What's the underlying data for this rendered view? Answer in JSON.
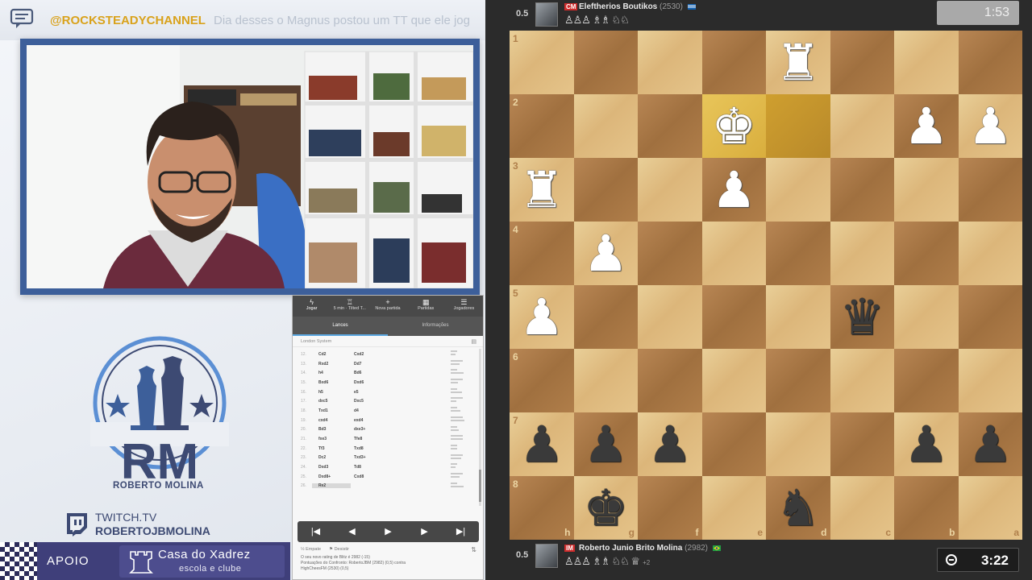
{
  "chat": {
    "user": "@ROCKSTEADYCHANNEL",
    "message": "Dia desses o Magnus postou um TT que ele jog"
  },
  "branding": {
    "logo_letters": "RM",
    "logo_name": "ROBERTO MOLINA",
    "twitch_line1": "TWITCH.TV",
    "twitch_line2": "ROBERTOJBMOLINA",
    "apoio_label": "APOIO",
    "sponsor_title": "Casa do Xadrez",
    "sponsor_subtitle": "escola e clube"
  },
  "panel": {
    "nav": [
      {
        "label": "Jogar",
        "icon": "lightning-icon"
      },
      {
        "label": "5 min · Tilted T...",
        "icon": "trophy-icon"
      },
      {
        "label": "Nova partida",
        "icon": "plus-icon"
      },
      {
        "label": "Partidas",
        "icon": "grid-icon"
      },
      {
        "label": "Jogadores",
        "icon": "users-icon"
      }
    ],
    "sub_tabs": [
      "Lances",
      "Informações"
    ],
    "opening": "London System",
    "moves": [
      {
        "n": "12.",
        "w": "Cd2",
        "b": "Cxd2"
      },
      {
        "n": "13.",
        "w": "Rxd2",
        "b": "Dd7"
      },
      {
        "n": "14.",
        "w": "h4",
        "b": "Bd6"
      },
      {
        "n": "15.",
        "w": "Bxd6",
        "b": "Dxd6"
      },
      {
        "n": "16.",
        "w": "h5",
        "b": "e5"
      },
      {
        "n": "17.",
        "w": "dxc5",
        "b": "Dxc5"
      },
      {
        "n": "18.",
        "w": "Txd1",
        "b": "d4"
      },
      {
        "n": "19.",
        "w": "cxd4",
        "b": "exd4"
      },
      {
        "n": "20.",
        "w": "Bd3",
        "b": "dxe3+"
      },
      {
        "n": "21.",
        "w": "fxe3",
        "b": "Tfe8"
      },
      {
        "n": "22.",
        "w": "Tf3",
        "b": "Txd8"
      },
      {
        "n": "23.",
        "w": "Dc2",
        "b": "Txd3+"
      },
      {
        "n": "24.",
        "w": "Dxd3",
        "b": "Td8"
      },
      {
        "n": "25.",
        "w": "Dxd8+",
        "b": "Cxd8"
      },
      {
        "n": "26.",
        "w": "Re2",
        "b": ""
      }
    ],
    "controls": [
      "⏮",
      "◀",
      "▶",
      "▶",
      "⏭"
    ],
    "footer": {
      "draw": "Empate",
      "resign": "Desistir",
      "rating_line1": "O seu novo rating de Blitz é 2982 (-15)",
      "rating_line2": "Pontuações do Confronto: RobertoJBM (2982) (0,5) contra",
      "rating_line3": "HighCheesFM (2530) (0,5)"
    }
  },
  "top_player": {
    "score": "0.5",
    "title": "CM",
    "name": "Eleftherios Boutikos",
    "rating": "(2530)",
    "captured": "♙♙♙ ♗♗ ♘♘",
    "clock": "1:53"
  },
  "bottom_player": {
    "score": "0.5",
    "title": "IM",
    "name": "Roberto Junio Brito Molina",
    "rating": "(2982)",
    "captured": "♙♙♙ ♗♗ ♘♘ ♕",
    "diff": "+2",
    "clock": "3:22"
  },
  "board": {
    "ranks": [
      "1",
      "2",
      "3",
      "4",
      "5",
      "6",
      "7",
      "8"
    ],
    "files": [
      "h",
      "g",
      "f",
      "e",
      "d",
      "c",
      "b",
      "a"
    ],
    "highlight": [
      [
        1,
        3
      ],
      [
        1,
        4
      ]
    ],
    "pieces": [
      {
        "r": 0,
        "c": 4,
        "p": "♜",
        "color": "white"
      },
      {
        "r": 1,
        "c": 3,
        "p": "♚",
        "color": "white"
      },
      {
        "r": 1,
        "c": 6,
        "p": "♟",
        "color": "white"
      },
      {
        "r": 1,
        "c": 7,
        "p": "♟",
        "color": "white"
      },
      {
        "r": 2,
        "c": 0,
        "p": "♜",
        "color": "white"
      },
      {
        "r": 2,
        "c": 3,
        "p": "♟",
        "color": "white"
      },
      {
        "r": 3,
        "c": 1,
        "p": "♟",
        "color": "white"
      },
      {
        "r": 4,
        "c": 0,
        "p": "♟",
        "color": "white"
      },
      {
        "r": 4,
        "c": 5,
        "p": "♛",
        "color": "black"
      },
      {
        "r": 6,
        "c": 0,
        "p": "♟",
        "color": "black"
      },
      {
        "r": 6,
        "c": 1,
        "p": "♟",
        "color": "black"
      },
      {
        "r": 6,
        "c": 2,
        "p": "♟",
        "color": "black"
      },
      {
        "r": 6,
        "c": 6,
        "p": "♟",
        "color": "black"
      },
      {
        "r": 6,
        "c": 7,
        "p": "♟",
        "color": "black"
      },
      {
        "r": 7,
        "c": 1,
        "p": "♚",
        "color": "black"
      },
      {
        "r": 7,
        "c": 4,
        "p": "♞",
        "color": "black"
      }
    ]
  },
  "colors": {
    "accent": "#3d5f9a",
    "chat_user": "#d9a21b",
    "title_badge": "#cc2b2b",
    "highlight": "#d9ae3d"
  }
}
